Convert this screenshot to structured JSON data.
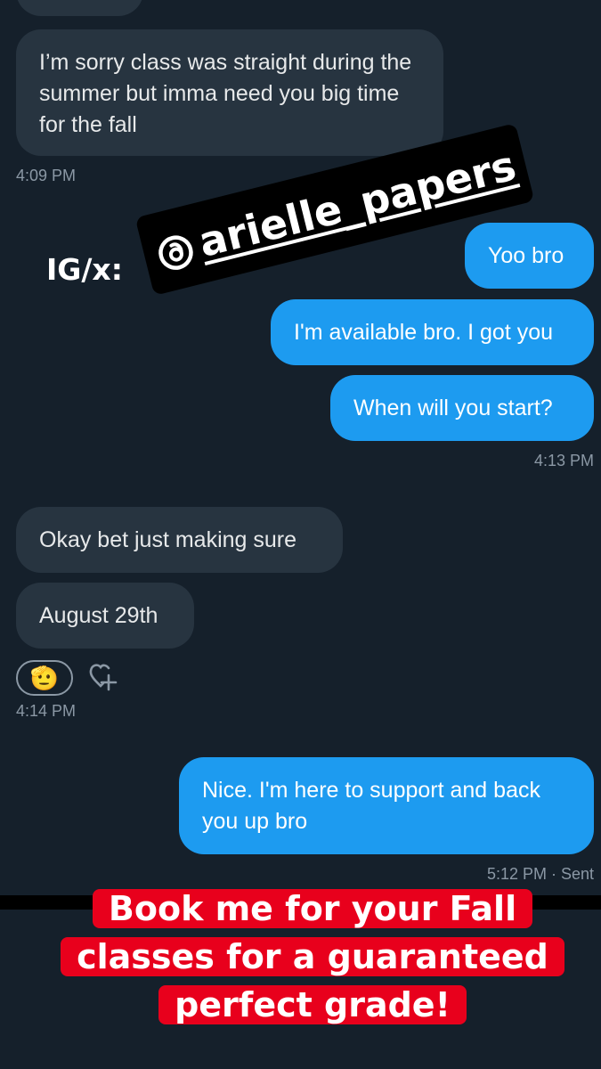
{
  "messages": [
    {
      "id": "m1",
      "direction": "in",
      "text": "I’m sorry class was straight during the summer but imma need you big time for the fall"
    },
    {
      "id": "m2",
      "direction": "out",
      "text": "Yoo bro"
    },
    {
      "id": "m3",
      "direction": "out",
      "text": "I'm available bro. I got you"
    },
    {
      "id": "m4",
      "direction": "out",
      "text": "When will you start?"
    },
    {
      "id": "m5",
      "direction": "in",
      "text": "Okay bet just making sure"
    },
    {
      "id": "m6",
      "direction": "in",
      "text": "August 29th"
    },
    {
      "id": "m7",
      "direction": "out",
      "text": "Nice. I'm here to support and back you up bro"
    }
  ],
  "timestamps": {
    "t1": "4:09 PM",
    "t2": "4:13 PM",
    "t3": "4:14 PM",
    "t4": "5:12 PM · Sent"
  },
  "reaction": {
    "emoji": "🫡",
    "add_icon": "heart-plus-icon"
  },
  "overlay": {
    "ig_label": "IG/x:",
    "handle": "arielle_papers",
    "handle_icon": "threads-icon",
    "promo": "Book me for your Fall classes for a guaranteed perfect grade!"
  },
  "colors": {
    "background": "#15202b",
    "incoming_bubble": "#273440",
    "outgoing_bubble": "#1d9bf0",
    "promo_bg": "#e8001c",
    "timestamp": "#8b98a5"
  }
}
